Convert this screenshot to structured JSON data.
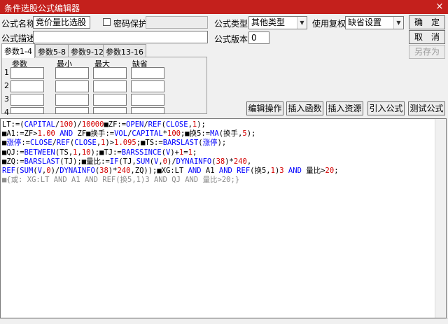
{
  "window": {
    "title": "条件选股公式编辑器",
    "close_glyph": "×"
  },
  "form": {
    "name_label": "公式名称",
    "name_value": "竞价量比选股",
    "password_label": "密码保护",
    "desc_label": "公式描述",
    "desc_value": "",
    "type_label": "公式类型",
    "type_value": "其他类型",
    "version_label": "公式版本",
    "version_value": "0",
    "rights_label": "使用复权",
    "rights_value": "缺省设置"
  },
  "buttons": {
    "ok": "确　定",
    "cancel": "取　消",
    "saveas": "另存为",
    "edit_op": "编辑操作",
    "insert_func": "插入函数",
    "insert_res": "插入资源",
    "import": "引入公式",
    "test": "测试公式"
  },
  "tabs": [
    "参数1-4",
    "参数5-8",
    "参数9-12",
    "参数13-16"
  ],
  "params": {
    "headers": [
      "参数",
      "最小",
      "最大",
      "缺省"
    ],
    "rows": [
      "1",
      "2",
      "3",
      "4"
    ]
  },
  "colors": {
    "black": "#000000",
    "blue": "#0000ff",
    "red": "#d40000",
    "magenta": "#c000c0",
    "gray": "#8c8c8c"
  },
  "code": [
    [
      [
        "LT:=(",
        "black"
      ],
      [
        "CAPITAL",
        "blue"
      ],
      [
        "/",
        "black"
      ],
      [
        "100",
        "red"
      ],
      [
        ")/",
        "black"
      ],
      [
        "10000",
        "red"
      ],
      [
        "■ZF:=",
        "black"
      ],
      [
        "OPEN",
        "blue"
      ],
      [
        "/",
        "black"
      ],
      [
        "REF",
        "blue"
      ],
      [
        "(",
        "black"
      ],
      [
        "CLOSE",
        "blue"
      ],
      [
        ",",
        "black"
      ],
      [
        "1",
        "red"
      ],
      [
        ");",
        "black"
      ]
    ],
    [
      [
        "■A1:=ZF>",
        "black"
      ],
      [
        "1.00",
        "red"
      ],
      [
        " ",
        "black"
      ],
      [
        "AND",
        "blue"
      ],
      [
        " ZF",
        "black"
      ],
      [
        "■换手:=",
        "black"
      ],
      [
        "VOL",
        "blue"
      ],
      [
        "/",
        "black"
      ],
      [
        "CAPITAL",
        "blue"
      ],
      [
        "*",
        "black"
      ],
      [
        "100",
        "red"
      ],
      [
        ";■换5:=",
        "black"
      ],
      [
        "MA",
        "blue"
      ],
      [
        "(换手,",
        "black"
      ],
      [
        "5",
        "red"
      ],
      [
        ");",
        "black"
      ]
    ],
    [
      [
        "■",
        "black"
      ],
      [
        "涨停",
        "blue"
      ],
      [
        ":=",
        "black"
      ],
      [
        "CLOSE",
        "blue"
      ],
      [
        "/",
        "black"
      ],
      [
        "REF",
        "blue"
      ],
      [
        "(",
        "black"
      ],
      [
        "CLOSE",
        "blue"
      ],
      [
        ",",
        "black"
      ],
      [
        "1",
        "red"
      ],
      [
        ")>",
        "black"
      ],
      [
        "1.095",
        "red"
      ],
      [
        ";■TS:=",
        "black"
      ],
      [
        "BARSLAST",
        "blue"
      ],
      [
        "(",
        "black"
      ],
      [
        "涨停",
        "blue"
      ],
      [
        ");",
        "black"
      ]
    ],
    [
      [
        "■QJ:=",
        "black"
      ],
      [
        "BETWEEN",
        "blue"
      ],
      [
        "(TS,",
        "black"
      ],
      [
        "1",
        "red"
      ],
      [
        ",",
        "black"
      ],
      [
        "10",
        "red"
      ],
      [
        ");■TJ:=",
        "black"
      ],
      [
        "BARSSINCE",
        "blue"
      ],
      [
        "(",
        "black"
      ],
      [
        "V",
        "blue"
      ],
      [
        ")+",
        "black"
      ],
      [
        "1",
        "red"
      ],
      [
        "=",
        "black"
      ],
      [
        "1",
        "red"
      ],
      [
        ";",
        "black"
      ]
    ],
    [
      [
        "■ZQ:=",
        "black"
      ],
      [
        "BARSLAST",
        "blue"
      ],
      [
        "(TJ);■量比:=",
        "black"
      ],
      [
        "IF",
        "blue"
      ],
      [
        "(TJ,",
        "black"
      ],
      [
        "SUM",
        "blue"
      ],
      [
        "(",
        "black"
      ],
      [
        "V",
        "blue"
      ],
      [
        ",",
        "black"
      ],
      [
        "0",
        "red"
      ],
      [
        ")/",
        "black"
      ],
      [
        "DYNAINFO",
        "blue"
      ],
      [
        "(",
        "black"
      ],
      [
        "38",
        "red"
      ],
      [
        ")*",
        "black"
      ],
      [
        "240",
        "red"
      ],
      [
        ",",
        "black"
      ]
    ],
    [
      [
        "REF",
        "blue"
      ],
      [
        "(",
        "black"
      ],
      [
        "SUM",
        "blue"
      ],
      [
        "(",
        "black"
      ],
      [
        "V",
        "blue"
      ],
      [
        ",",
        "black"
      ],
      [
        "0",
        "red"
      ],
      [
        ")/",
        "black"
      ],
      [
        "DYNAINFO",
        "blue"
      ],
      [
        "(",
        "black"
      ],
      [
        "38",
        "red"
      ],
      [
        ")*",
        "black"
      ],
      [
        "240",
        "red"
      ],
      [
        ",ZQ));■XG:LT ",
        "black"
      ],
      [
        "AND",
        "blue"
      ],
      [
        " A1 ",
        "black"
      ],
      [
        "AND",
        "blue"
      ],
      [
        " ",
        "black"
      ],
      [
        "REF",
        "blue"
      ],
      [
        "(换5,",
        "black"
      ],
      [
        "1",
        "red"
      ],
      [
        ")",
        "black"
      ],
      [
        "3",
        "red"
      ],
      [
        " ",
        "black"
      ],
      [
        "AND",
        "blue"
      ],
      [
        " 量比>",
        "black"
      ],
      [
        "20",
        "red"
      ],
      [
        ";",
        "black"
      ]
    ],
    [
      [
        "■{或: XG:LT AND A1 AND REF(换5,1)3 AND QJ AND 量比>20;}",
        "gray"
      ]
    ]
  ]
}
